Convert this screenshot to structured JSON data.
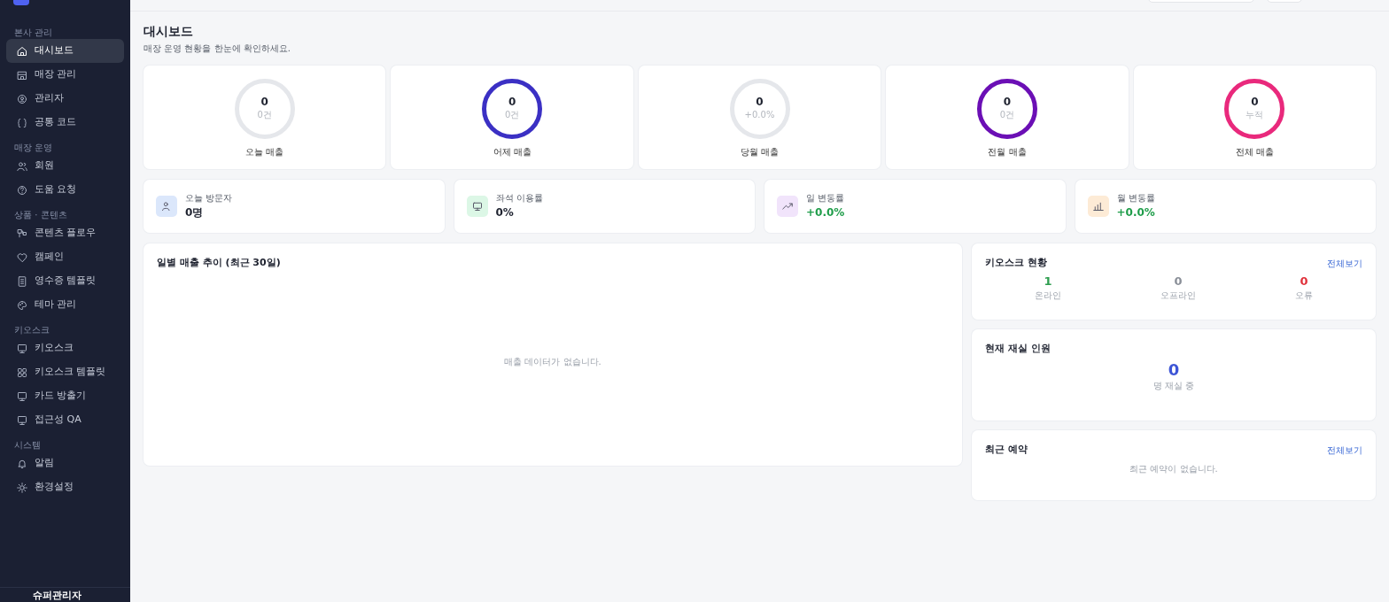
{
  "sidebar": {
    "sections": [
      {
        "title": "본사 관리",
        "items": [
          {
            "label": "대시보드",
            "selected": true
          },
          {
            "label": "매장 관리",
            "selected": false
          },
          {
            "label": "관리자",
            "selected": false
          },
          {
            "label": "공통 코드",
            "selected": false
          }
        ]
      },
      {
        "title": "매장 운영",
        "items": [
          {
            "label": "회원",
            "selected": false
          },
          {
            "label": "도움 요청",
            "selected": false
          }
        ]
      },
      {
        "title": "상품 · 콘텐츠",
        "items": [
          {
            "label": "콘텐츠 플로우",
            "selected": false
          },
          {
            "label": "캠페인",
            "selected": false
          },
          {
            "label": "영수증 템플릿",
            "selected": false
          },
          {
            "label": "테마 관리",
            "selected": false
          }
        ]
      },
      {
        "title": "키오스크",
        "items": [
          {
            "label": "키오스크",
            "selected": false
          },
          {
            "label": "키오스크 템플릿",
            "selected": false
          },
          {
            "label": "카드 방출기",
            "selected": false
          },
          {
            "label": "접근성 QA",
            "selected": false
          }
        ]
      },
      {
        "title": "시스템",
        "items": [
          {
            "label": "알림",
            "selected": false
          },
          {
            "label": "환경설정",
            "selected": false
          }
        ]
      }
    ],
    "user": "슈퍼관리자"
  },
  "page": {
    "title": "대시보드",
    "subtitle": "매장 운영 현황을 한눈에 확인하세요."
  },
  "sales_cards": [
    {
      "value": "0",
      "sub": "0건",
      "label": "오늘 매출",
      "color": "#e5e7eb"
    },
    {
      "value": "0",
      "sub": "0건",
      "label": "어제 매출",
      "color": "#3b30c4"
    },
    {
      "value": "0",
      "sub": "+0.0%",
      "label": "당월 매출",
      "color": "#e5e7eb"
    },
    {
      "value": "0",
      "sub": "0건",
      "label": "전월 매출",
      "color": "#6b0fb5"
    },
    {
      "value": "0",
      "sub": "누적",
      "label": "전체 매출",
      "color": "#e9297c"
    }
  ],
  "stat_cards": [
    {
      "label": "오늘 방문자",
      "value": "0명",
      "color": "#dbe7fb",
      "kind": "count"
    },
    {
      "label": "좌석 이용률",
      "value": "0%",
      "color": "#dcf7e6",
      "kind": "count"
    },
    {
      "label": "일 변동률",
      "value": "+0.0%",
      "color": "#f1e4fb",
      "kind": "change"
    },
    {
      "label": "월 변동률",
      "value": "+0.0%",
      "color": "#fdebd6",
      "kind": "change"
    }
  ],
  "sales_chart": {
    "title": "일별 매출 추이 (최근 30일)",
    "empty": "매출 데이터가 없습니다."
  },
  "kiosk_status": {
    "title": "키오스크 현황",
    "link": "전체보기",
    "counts": [
      {
        "value": "1",
        "label": "온라인",
        "color": "#2e9e4f"
      },
      {
        "value": "0",
        "label": "오프라인",
        "color": "#8a8f98"
      },
      {
        "value": "0",
        "label": "오류",
        "color": "#e0313b"
      }
    ]
  },
  "occupancy": {
    "title": "현재 재실 인원",
    "value": "0",
    "label": "명 재실 중"
  },
  "reservations": {
    "title": "최근 예약",
    "link": "전체보기",
    "empty": "최근 예약이 없습니다."
  }
}
